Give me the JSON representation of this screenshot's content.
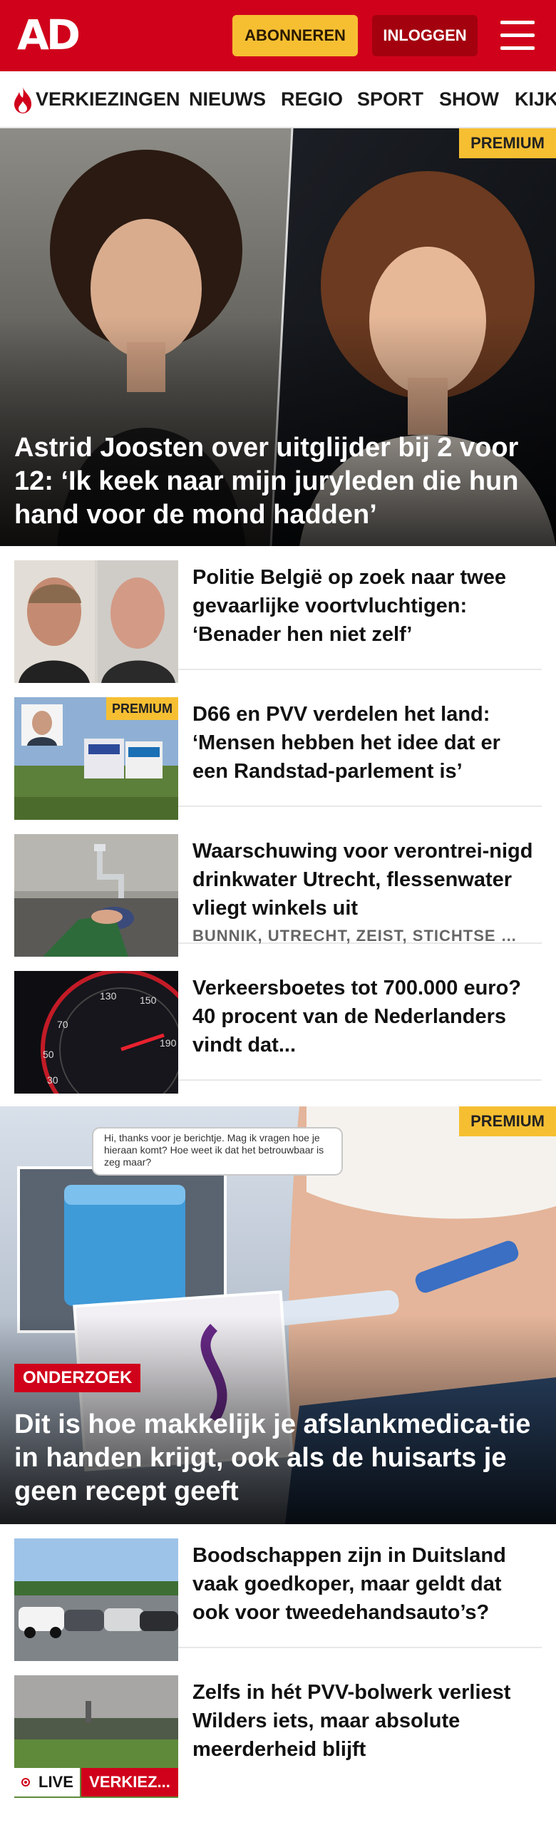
{
  "header": {
    "logo": "AD",
    "subscribe_label": "ABONNEREN",
    "login_label": "INLOGGEN"
  },
  "nav": {
    "items": [
      "VERKIEZINGEN",
      "NIEUWS",
      "REGIO",
      "SPORT",
      "SHOW",
      "KIJK"
    ]
  },
  "hero_top": {
    "badge": "PREMIUM",
    "title": "Astrid Joosten over uitglijder bij 2 voor 12: ‘Ik keek naar mijn juryleden die hun hand voor de mond hadden’"
  },
  "articles_a": [
    {
      "title": "Politie België op zoek naar twee gevaarlijke voortvluchtigen: ‘Benader hen niet zelf’",
      "meta": "",
      "premium": ""
    },
    {
      "title": "D66 en PVV verdelen het land: ‘Mensen hebben het idee dat er een Randstad-parlement is’",
      "meta": "",
      "premium": "PREMIUM"
    },
    {
      "title": "Waarschuwing voor verontrei-nigd drinkwater Utrecht, flessenwater vliegt winkels uit",
      "meta": "BUNNIK, UTRECHT, ZEIST, STICHTSE VECHT",
      "premium": ""
    },
    {
      "title": "Verkeersboetes tot 700.000 euro? 40 procent van de Nederlanders vindt dat...",
      "meta": "",
      "premium": ""
    }
  ],
  "hero_mid": {
    "badge": "PREMIUM",
    "tag": "ONDERZOEK",
    "chat_text": "Hi, thanks voor je berichtje. Mag ik vragen hoe je hieraan komt? Hoe weet ik dat het betrouwbaar is zeg maar?",
    "title": "Dit is hoe makkelijk je afslankmedica-tie in handen krijgt, ook als de huisarts je geen recept geeft"
  },
  "articles_b": [
    {
      "title": "Boodschappen zijn in Duitsland vaak goedkoper, maar geldt dat ook voor tweedehandsauto’s?"
    },
    {
      "title": "Zelfs in hét PVV-bolwerk verliest Wilders iets, maar absolute meerderheid blijft"
    }
  ],
  "live": {
    "label": "LIVE",
    "tag": "VERKIEZ..."
  },
  "colors": {
    "brand_red": "#d0021b",
    "premium_yellow": "#f6bf32",
    "login_dark_red": "#a4010f"
  }
}
